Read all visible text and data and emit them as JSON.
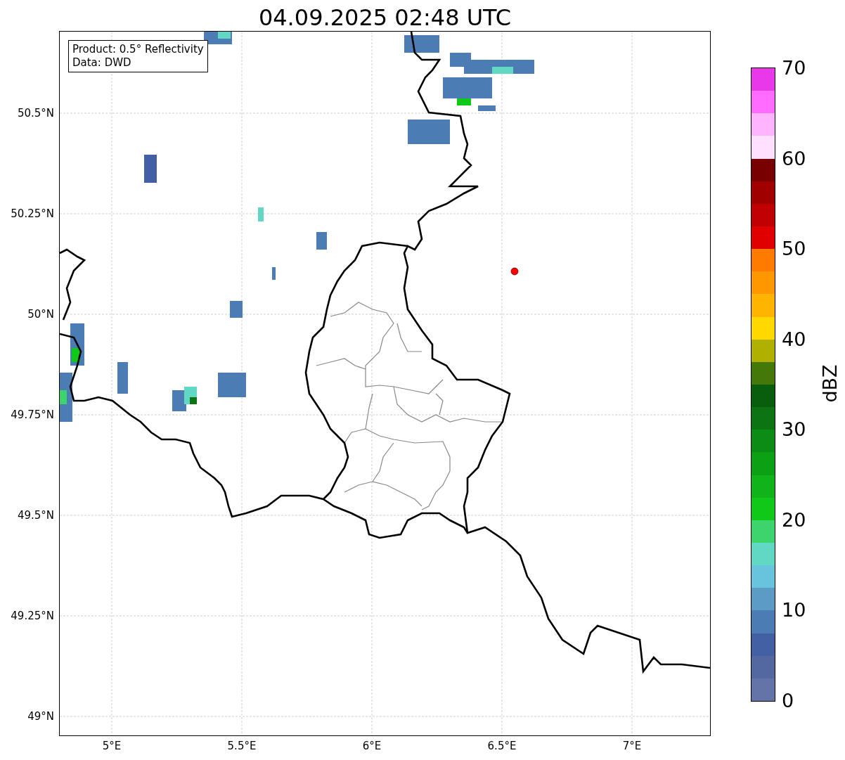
{
  "title": "04.09.2025 02:48 UTC",
  "info_box": {
    "lines": [
      "Product: 0.5° Reflectivity",
      "Data: DWD"
    ]
  },
  "map": {
    "y_ticks": [
      "50.5°N",
      "50.25°N",
      "50°N",
      "49.75°N",
      "49.5°N",
      "49.25°N",
      "49°N"
    ],
    "x_ticks": [
      "5°E",
      "5.5°E",
      "6°E",
      "6.5°E",
      "7°E"
    ]
  },
  "colorbar": {
    "label": "dBZ",
    "ticks": [
      "70",
      "60",
      "50",
      "40",
      "30",
      "20",
      "10",
      "0"
    ],
    "segments": [
      {
        "color": "#e838e8"
      },
      {
        "color": "#ff6cff"
      },
      {
        "color": "#ffb4ff"
      },
      {
        "color": "#ffe0ff"
      },
      {
        "color": "#780000"
      },
      {
        "color": "#a00000"
      },
      {
        "color": "#c00000"
      },
      {
        "color": "#e00000"
      },
      {
        "color": "#ff7c00"
      },
      {
        "color": "#ff9800"
      },
      {
        "color": "#ffb400"
      },
      {
        "color": "#ffd800"
      },
      {
        "color": "#b0b000"
      },
      {
        "color": "#447808"
      },
      {
        "color": "#085e0c"
      },
      {
        "color": "#0c7410"
      },
      {
        "color": "#0c8c14"
      },
      {
        "color": "#0ca014"
      },
      {
        "color": "#10b418"
      },
      {
        "color": "#10c818"
      },
      {
        "color": "#3cd46c"
      },
      {
        "color": "#60d8c4"
      },
      {
        "color": "#68c4dc"
      },
      {
        "color": "#5c9cc4"
      },
      {
        "color": "#4c7cb4"
      },
      {
        "color": "#4460a4"
      },
      {
        "color": "#5468a0"
      },
      {
        "color": "#6474a8"
      }
    ]
  }
}
